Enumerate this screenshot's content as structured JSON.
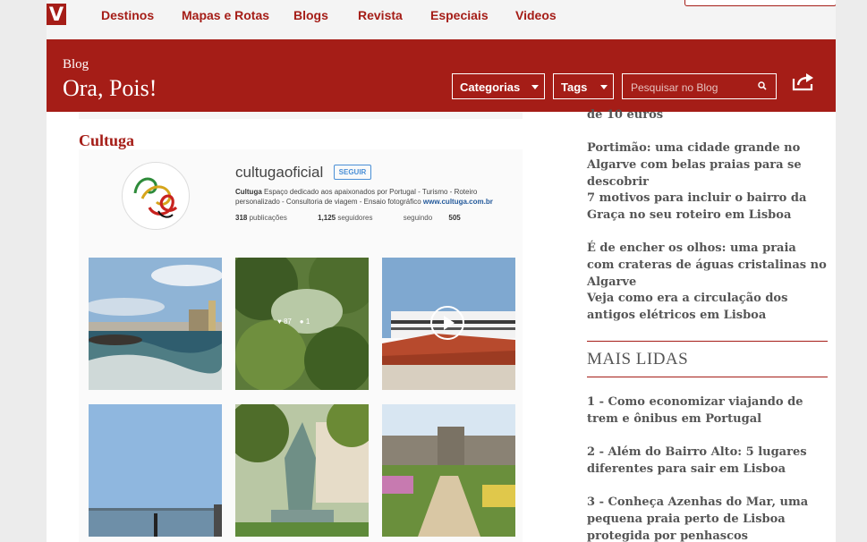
{
  "nav": {
    "logo": "V",
    "items": [
      "Destinos",
      "Mapas e Rotas",
      "Blogs",
      "Revista",
      "Especiais",
      "Videos"
    ]
  },
  "header": {
    "kicker": "Blog",
    "title": "Ora, Pois!",
    "categories_label": "Categorias",
    "tags_label": "Tags",
    "search_placeholder": "Pesquisar no Blog"
  },
  "main": {
    "section_title": "Cultuga",
    "instagram": {
      "username": "cultugaoficial",
      "follow_label": "SEGUIR",
      "bio_name": "Cultuga",
      "bio_text": " Espaço dedicado aos apaixonados por Portugal - Turismo - Roteiro personalizado - Consultoria de viagem - Ensaio fotográfico ",
      "bio_link": "www.cultuga.com.br",
      "posts_count": "318",
      "posts_label": " publicações",
      "followers_count": "1,125",
      "followers_label": " seguidores",
      "following_label": "seguindo ",
      "following_count": "505",
      "photo2_likes": "♥ 87",
      "photo2_comments": "● 1"
    }
  },
  "sidebar": {
    "partial_item": "de 10 euros",
    "recent": [
      "Portimão: uma cidade grande no Algarve com belas praias para se descobrir",
      "7 motivos para incluir o bairro da Graça no seu roteiro em Lisboa",
      "É de encher os olhos: uma praia com crateras de águas cristalinas no Algarve",
      "Veja como era a circulação dos antigos elétricos em Lisboa"
    ],
    "most_read_title": "MAIS LIDAS",
    "most_read": [
      "1 - Como economizar viajando de trem e ônibus em Portugal",
      "2 - Além do Bairro Alto: 5 lugares diferentes para sair em Lisboa",
      "3 - Conheça Azenhas do Mar, uma pequena praia perto de Lisboa protegida por penhascos"
    ]
  },
  "colors": {
    "brand": "#a51d17",
    "text": "#555555"
  }
}
